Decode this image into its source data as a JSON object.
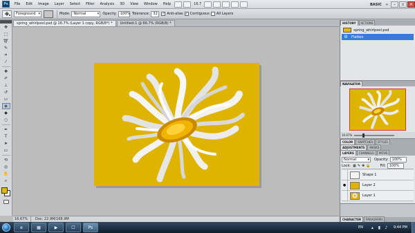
{
  "app": {
    "logo_text": "Ps",
    "menu": [
      "File",
      "Edit",
      "Image",
      "Layer",
      "Select",
      "Filter",
      "Analysis",
      "3D",
      "View",
      "Window",
      "Help"
    ],
    "zoom_menu": "16.7",
    "workspace": "BASIC",
    "workspace_arrow": "»",
    "window_controls": [
      "–",
      "▫",
      "×"
    ]
  },
  "options_bar": {
    "sample_source": "Foreground",
    "mode_label": "Mode:",
    "mode_value": "Normal",
    "opacity_label": "Opacity:",
    "opacity_value": "100%",
    "tolerance_label": "Tolerance:",
    "tolerance_value": "32",
    "antialias_label": "Anti-alias",
    "antialias_checked": "✓",
    "contiguous_label": "Contiguous",
    "contiguous_checked": "✓",
    "all_layers_label": "All Layers"
  },
  "documents": [
    {
      "label": "spring_whirlpool.psd @ 16.7% (Layer 1 copy, RGB/8*) *"
    },
    {
      "label": "Untitled-1 @ 66.7% (RGB/8) *"
    }
  ],
  "status": {
    "zoom": "16.67%",
    "doc": "Doc: 22.9M/168.9M"
  },
  "history": {
    "tabs": [
      "HISTORY",
      "ACTIONS"
    ],
    "items": [
      {
        "label": "spring_whirlpool.psd"
      },
      {
        "label": "Flatten"
      }
    ]
  },
  "navigator": {
    "tab": "NAVIGATOR",
    "zoom": "16.67%"
  },
  "color_tabs": [
    "COLOR",
    "SWATCHES",
    "STYLES"
  ],
  "adjust_tabs": [
    "ADJUSTMENTS",
    "MASKS"
  ],
  "layers": {
    "tabs": [
      "LAYERS",
      "CHANNELS",
      "PATHS"
    ],
    "blend_mode": "Normal",
    "opacity_label": "Opacity:",
    "opacity_value": "100%",
    "lock_label": "Lock:",
    "fill_label": "Fill:",
    "fill_value": "100%",
    "rows": [
      {
        "name": "Shape 1",
        "visible": ""
      },
      {
        "name": "Layer 2",
        "visible": "●"
      },
      {
        "name": "Layer 1",
        "visible": ""
      }
    ]
  },
  "bottom_tabs": [
    "CHARACTER",
    "PARAGRAPH"
  ],
  "taskbar": {
    "apps": [
      "e",
      "▦",
      "▶",
      "☐",
      "Ps"
    ],
    "lang": "EN",
    "time": "9:44 PM"
  },
  "colors": {
    "canvas": "#dfb400",
    "foreground": "#e1ba00",
    "background": "#ffffff",
    "selection": "#3a7bd5"
  }
}
